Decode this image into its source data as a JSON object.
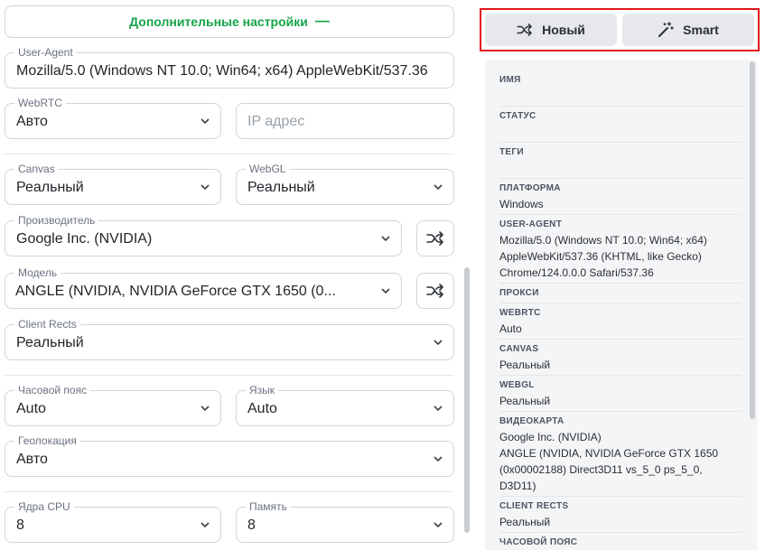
{
  "advanced": {
    "label": "Дополнительные настройки",
    "toggle_glyph": "—"
  },
  "fields": {
    "user_agent": {
      "label": "User-Agent",
      "value": "Mozilla/5.0 (Windows NT 10.0; Win64; x64) AppleWebKit/537.36"
    },
    "webrtc": {
      "label": "WebRTC",
      "value": "Авто"
    },
    "ip": {
      "placeholder": "IP адрес"
    },
    "canvas": {
      "label": "Canvas",
      "value": "Реальный"
    },
    "webgl": {
      "label": "WebGL",
      "value": "Реальный"
    },
    "vendor": {
      "label": "Производитель",
      "value": "Google Inc. (NVIDIA)"
    },
    "model": {
      "label": "Модель",
      "value": "ANGLE (NVIDIA, NVIDIA GeForce GTX 1650 (0..."
    },
    "client_rects": {
      "label": "Client Rects",
      "value": "Реальный"
    },
    "timezone": {
      "label": "Часовой пояс",
      "value": "Auto"
    },
    "language": {
      "label": "Язык",
      "value": "Auto"
    },
    "geo": {
      "label": "Геолокация",
      "value": "Авто"
    },
    "cpu": {
      "label": "Ядра CPU",
      "value": "8"
    },
    "memory": {
      "label": "Память",
      "value": "8"
    }
  },
  "actions": {
    "new_label": "Новый",
    "smart_label": "Smart"
  },
  "summary": {
    "name": {
      "label": "ИМЯ",
      "value": ""
    },
    "status": {
      "label": "СТАТУС",
      "value": ""
    },
    "tags": {
      "label": "ТЕГИ",
      "value": ""
    },
    "platform": {
      "label": "ПЛАТФОРМА",
      "value": "Windows"
    },
    "user_agent": {
      "label": "USER-AGENT",
      "line1": "Mozilla/5.0 (Windows NT 10.0; Win64; x64)",
      "line2": "AppleWebKit/537.36 (KHTML, like Gecko)",
      "line3": "Chrome/124.0.0.0 Safari/537.36"
    },
    "proxy": {
      "label": "ПРОКСИ",
      "value": ""
    },
    "webrtc": {
      "label": "WEBRTC",
      "value": "Auto"
    },
    "canvas": {
      "label": "CANVAS",
      "value": "Реальный"
    },
    "webgl": {
      "label": "WEBGL",
      "value": "Реальный"
    },
    "gpu": {
      "label": "ВИДЕОКАРТА",
      "line1": "Google Inc. (NVIDIA)",
      "line2": "ANGLE (NVIDIA, NVIDIA GeForce GTX 1650",
      "line3": "(0x00002188) Direct3D11 vs_5_0 ps_5_0,",
      "line4": "D3D11)"
    },
    "client_rects": {
      "label": "CLIENT RECTS",
      "value": "Реальный"
    },
    "timezone": {
      "label": "ЧАСОВОЙ ПОЯС"
    }
  },
  "colors": {
    "accent_green": "#16a34a",
    "highlight_red": "#e0141e"
  }
}
